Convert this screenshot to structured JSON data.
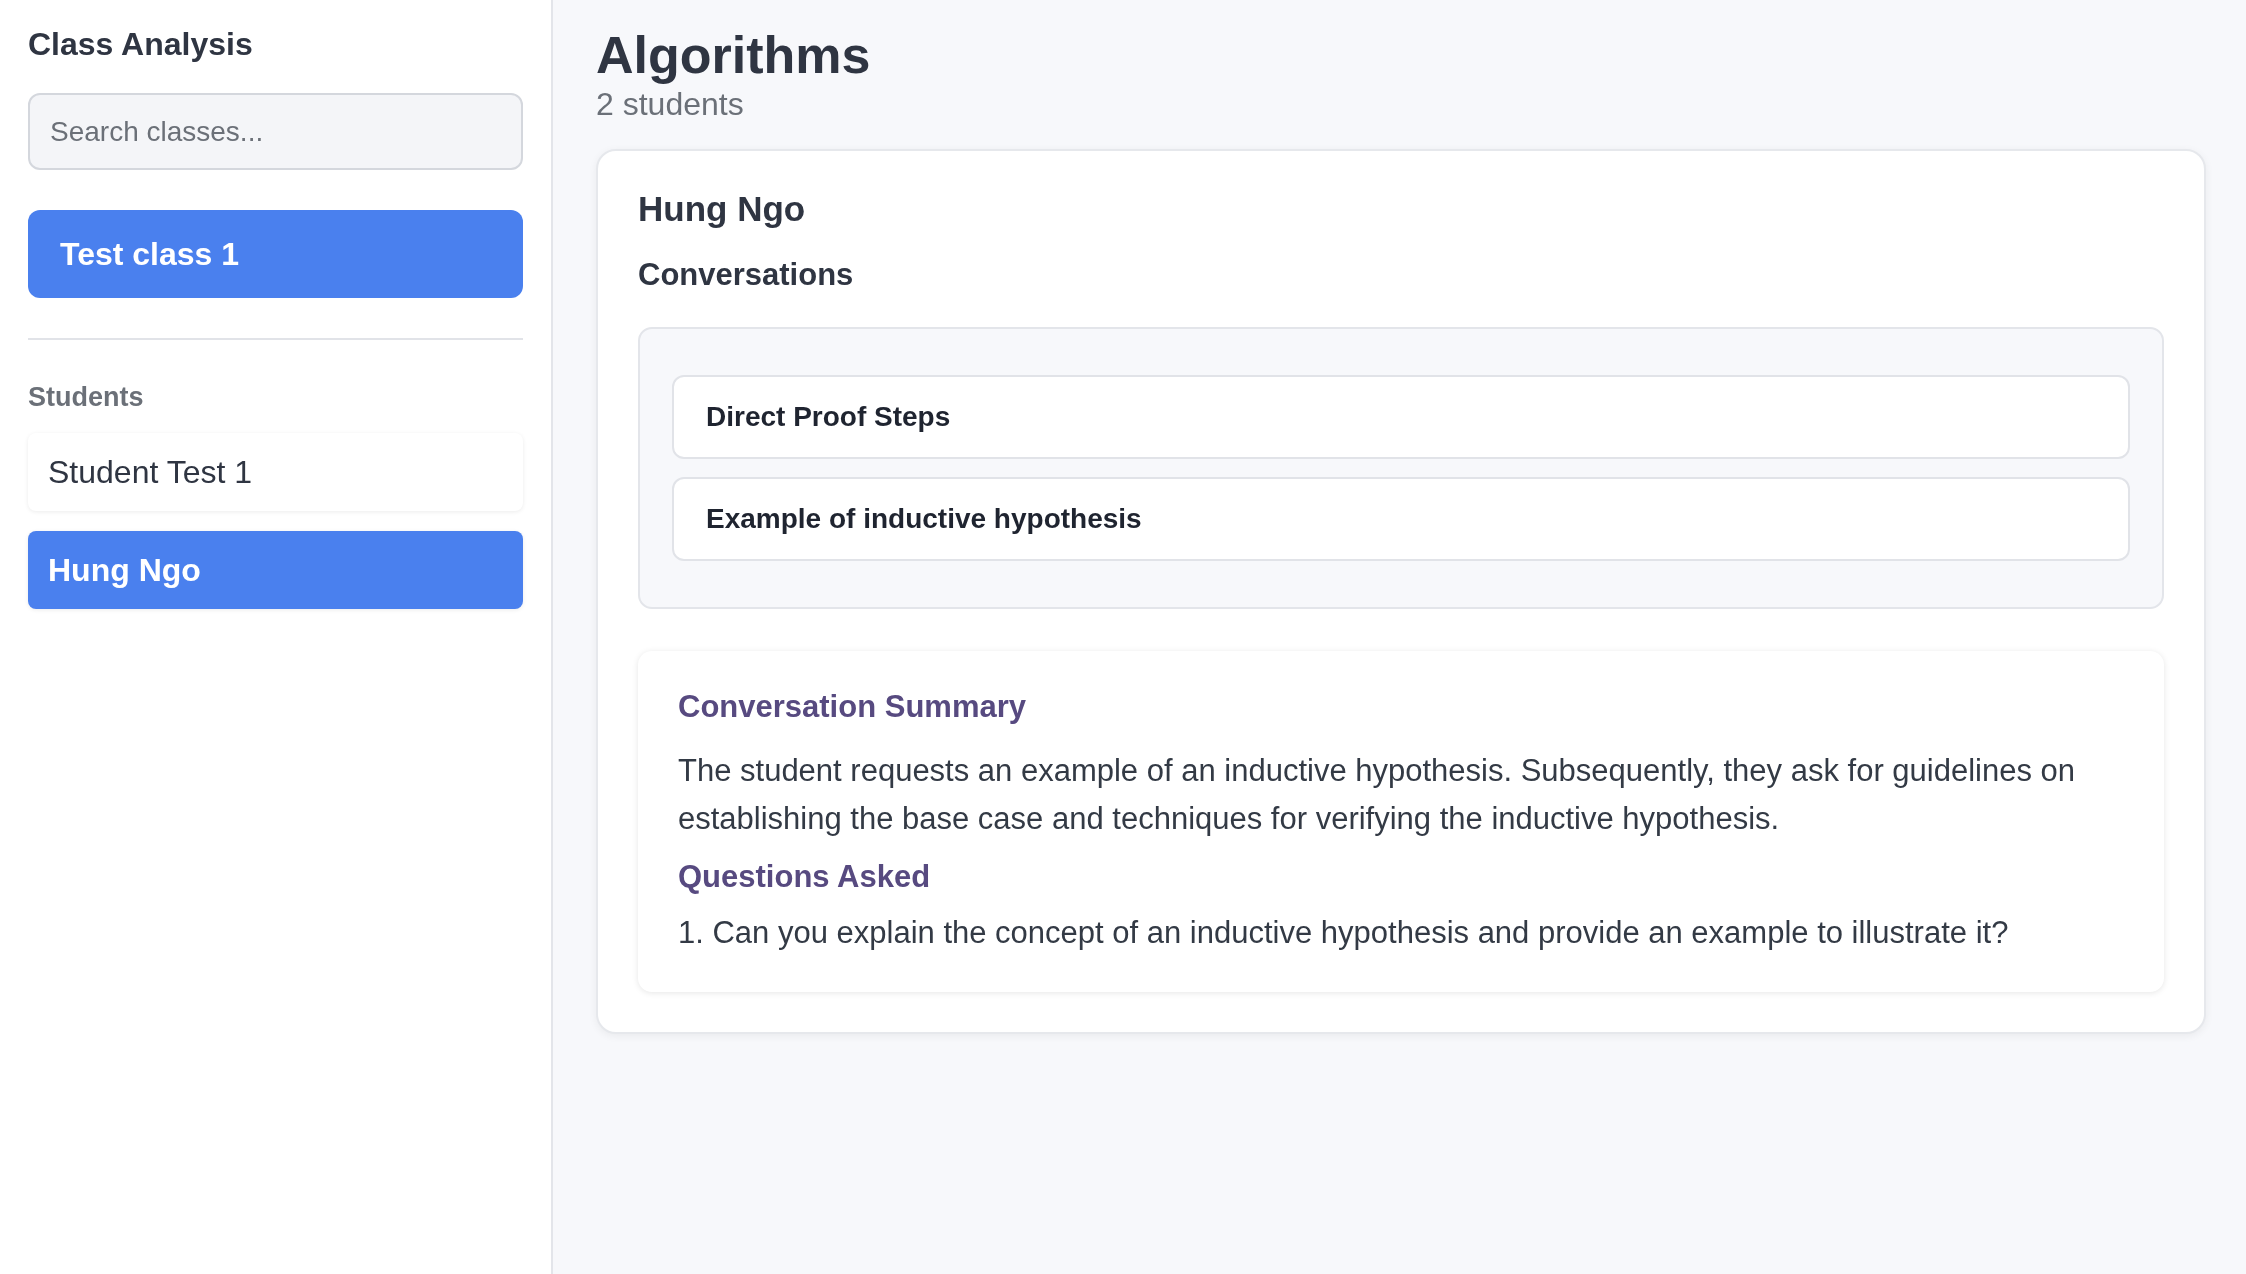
{
  "sidebar": {
    "title": "Class Analysis",
    "search": {
      "placeholder": "Search classes..."
    },
    "classes": [
      {
        "label": "Test class 1",
        "selected": true
      }
    ],
    "students_heading": "Students",
    "students": [
      {
        "name": "Student Test 1",
        "selected": false
      },
      {
        "name": "Hung Ngo",
        "selected": true
      }
    ]
  },
  "main": {
    "title": "Algorithms",
    "subtitle": "2 students",
    "student_name": "Hung Ngo",
    "conversations_heading": "Conversations",
    "conversations": [
      {
        "title": "Direct Proof Steps"
      },
      {
        "title": "Example of inductive hypothesis"
      }
    ],
    "summary": {
      "heading": "Conversation Summary",
      "text": "The student requests an example of an inductive hypothesis. Subsequently, they ask for guidelines on establishing the base case and techniques for verifying the inductive hypothesis.",
      "questions_heading": "Questions Asked",
      "questions": [
        "1. Can you explain the concept of an inductive hypothesis and provide an example to illustrate it?"
      ]
    }
  }
}
